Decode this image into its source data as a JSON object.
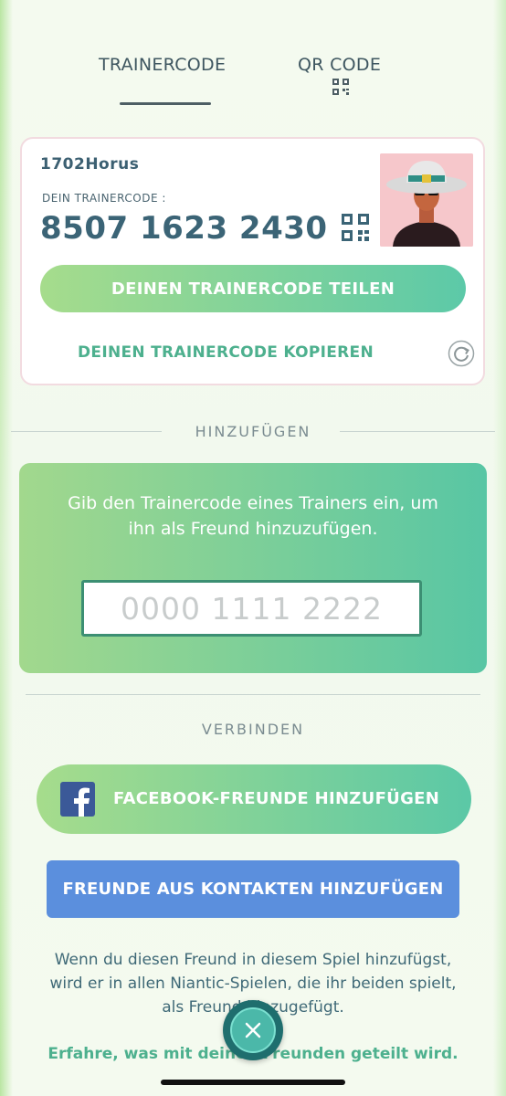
{
  "tabs": [
    {
      "label": "TRAINERCODE",
      "active": true
    },
    {
      "label": "QR CODE",
      "active": false
    }
  ],
  "trainer": {
    "name": "1702Horus",
    "code_label": "DEIN TRAINERCODE :",
    "code": "8507 1623 2430",
    "share_button": "DEINEN TRAINERCODE TEILEN",
    "copy_link": "DEINEN TRAINERCODE KOPIEREN"
  },
  "add_section": {
    "heading": "HINZUFÜGEN",
    "instruction": "Gib den Trainercode eines Trainers ein, um ihn als Freund hinzuzufügen.",
    "input_placeholder": "0000 1111 2222"
  },
  "connect_section": {
    "heading": "VERBINDEN",
    "facebook_button": "FACEBOOK-FREUNDE HINZUFÜGEN",
    "contacts_button": "FREUNDE AUS KONTAKTEN HINZUFÜGEN",
    "info_text": "Wenn du diesen Freund in diesem Spiel hinzufügst, wird er in allen Niantic-Spielen, die ihr beiden spielt, als Freund hinzugefügt.",
    "learn_more": "Erfahre, was mit deinen Freunden geteilt wird."
  },
  "colors": {
    "accent_green": "#5cc9a8",
    "link_green": "#4db08e",
    "text_dark": "#3b6476",
    "contacts_blue": "#5b8fdd",
    "facebook_blue": "#3b5998"
  },
  "icons": [
    "qr-code-icon",
    "refresh-icon",
    "facebook-icon",
    "close-icon"
  ]
}
